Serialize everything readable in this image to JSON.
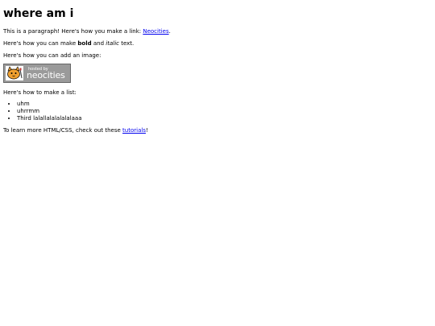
{
  "page": {
    "title": "where am i",
    "paragraph_link_prefix": "This is a paragraph! Here's how you make a link: ",
    "paragraph_link_text": "Neocities",
    "paragraph_link_suffix": ".",
    "bold_prefix": "Here's how you can make ",
    "bold_text": "bold",
    "bold_middle": " and ",
    "italic_text": "italic",
    "bold_suffix": " text.",
    "image_intro": "Here's how you can add an image:",
    "badge": {
      "small_text": "hosted by",
      "big_text": "neocities",
      "icon": "neocities-cat-icon"
    },
    "list_intro": "Here's how to make a list:",
    "list_items": [
      "uhm",
      "uhrrmm",
      "Third lalallalalalalalaaa"
    ],
    "outro_prefix": "To learn more HTML/CSS, check out these ",
    "outro_link_text": "tutorials",
    "outro_suffix": "!"
  },
  "colors": {
    "link": "#0000ee",
    "badge_bg": "#9a9a9a",
    "cat_orange": "#f0a030"
  }
}
